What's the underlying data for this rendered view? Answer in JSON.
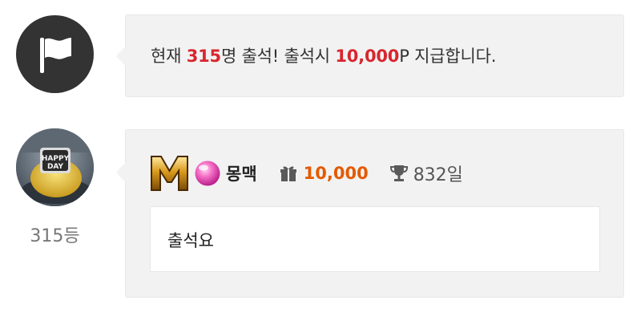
{
  "notice": {
    "prefix": "현재 ",
    "count": "315",
    "middle": "명 출석! 출석시 ",
    "reward": "10,000",
    "suffix": "P 지급합니다.",
    "icon": "flag-icon",
    "highlight_color": "#d8262f"
  },
  "comment": {
    "rank_label": "315등",
    "level_badge": "M",
    "nickname": "몽맥",
    "points": "10,000",
    "days": "832일",
    "text": "출석요",
    "points_color": "#e35a00"
  },
  "avatar_caption": {
    "text_top": "HAPPY",
    "text_bottom": "DAY"
  }
}
